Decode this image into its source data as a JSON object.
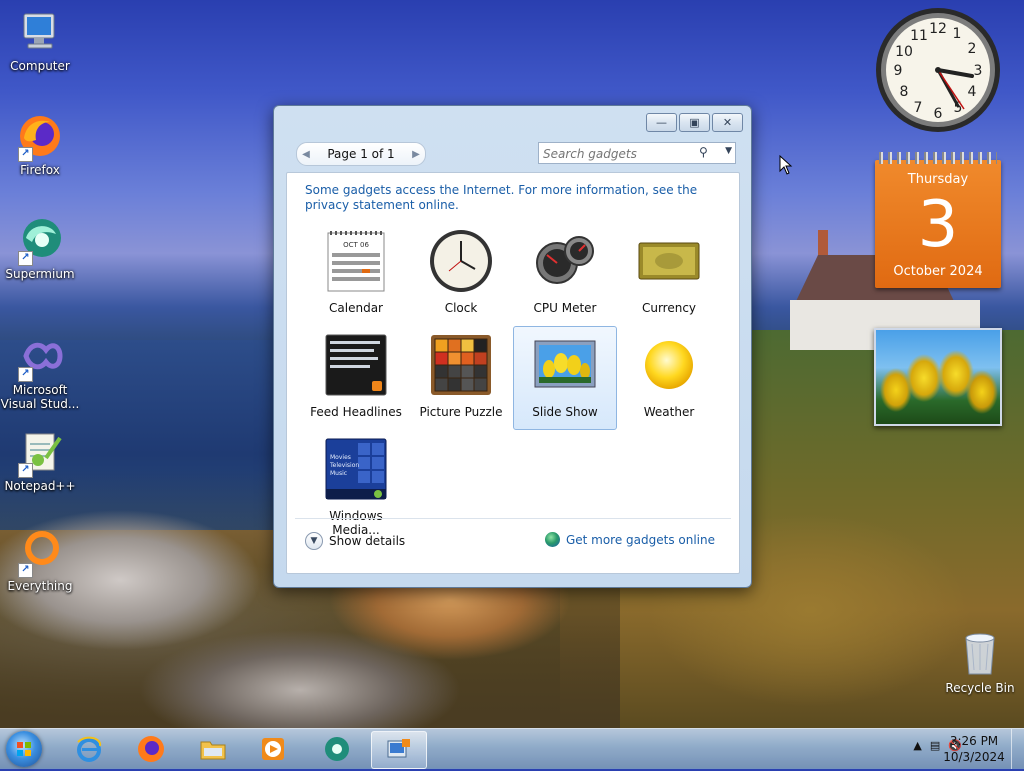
{
  "desktop": {
    "icons": [
      {
        "label": "Computer"
      },
      {
        "label": "Firefox"
      },
      {
        "label": "Supermium"
      },
      {
        "label": "Microsoft Visual Stud..."
      },
      {
        "label": "Notepad++"
      },
      {
        "label": "Everything"
      }
    ],
    "recycle_bin": "Recycle Bin"
  },
  "gadgets": {
    "clock_numbers": [
      "12",
      "1",
      "2",
      "3",
      "4",
      "5",
      "6",
      "7",
      "8",
      "9",
      "10",
      "11"
    ],
    "calendar": {
      "weekday": "Thursday",
      "day": "3",
      "month": "October 2024"
    }
  },
  "gallery": {
    "pager": {
      "label": "Page 1 of 1"
    },
    "search": {
      "placeholder": "Search gadgets"
    },
    "notice": "Some gadgets access the Internet.  For more information, see the privacy statement online.",
    "items": [
      {
        "label": "Calendar"
      },
      {
        "label": "Clock"
      },
      {
        "label": "CPU Meter"
      },
      {
        "label": "Currency"
      },
      {
        "label": "Feed Headlines"
      },
      {
        "label": "Picture Puzzle"
      },
      {
        "label": "Slide Show"
      },
      {
        "label": "Weather"
      },
      {
        "label": "Windows Media..."
      }
    ],
    "calendar_thumb_month": "OCT 06",
    "media_thumb_lines": [
      "Movies",
      "Television",
      "Music"
    ],
    "show_details": "Show details",
    "get_more": "Get more gadgets online"
  },
  "taskbar": {
    "time": "3:26 PM",
    "date": "10/3/2024"
  },
  "colors": {
    "link": "#1a5ea8",
    "calendar_orange": "#e06a12"
  }
}
